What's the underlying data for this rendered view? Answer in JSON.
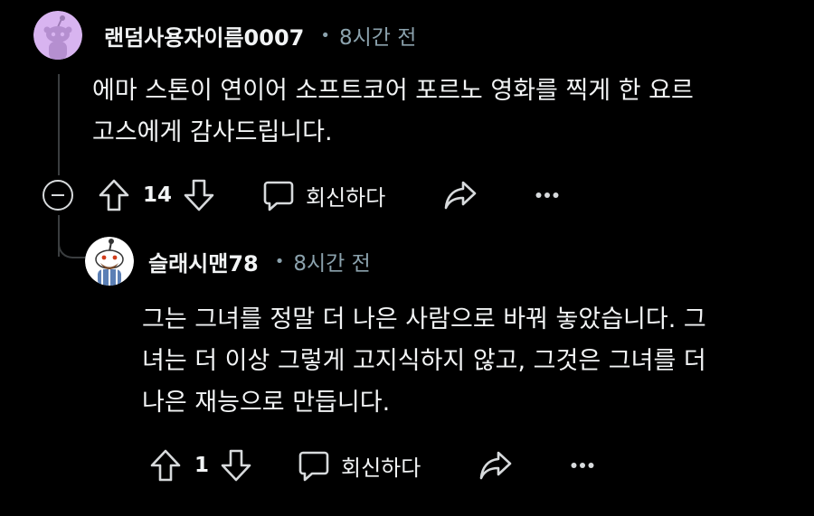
{
  "comments": [
    {
      "author": "랜덤사용자이름0007",
      "separator": "•",
      "time": "8시간 전",
      "body_lines": [
        "에마 스톤이 연이어 소프트코어 포르노 영화를 찍게 한 요르",
        "고스에게 감사드립니다."
      ],
      "vote_count": "14",
      "reply_label": "회신하다",
      "more_label": "•••",
      "avatar_color": "#d8b4f0"
    },
    {
      "author": "슬래시맨78",
      "separator": "•",
      "time": "8시간 전",
      "body_lines": [
        "그는 그녀를 정말 더 나은 사람으로 바꿔 놓았습니다. 그",
        "녀는 더 이상 그렇게 고지식하지 않고, 그것은 그녀를 더",
        "나은 재능으로 만듭니다."
      ],
      "vote_count": "1",
      "reply_label": "회신하다",
      "more_label": "•••",
      "avatar_color": "#ffffff"
    }
  ],
  "icons": {
    "upvote": "arrow-up-icon",
    "downvote": "arrow-down-icon",
    "reply": "speech-bubble-icon",
    "share": "share-arrow-icon",
    "more": "ellipsis-icon",
    "collapse": "minus-circle-icon"
  },
  "colors": {
    "background": "#000000",
    "text": "#f2f4f5",
    "meta": "#8ba2ad",
    "thread_line": "#3a3d3f"
  }
}
